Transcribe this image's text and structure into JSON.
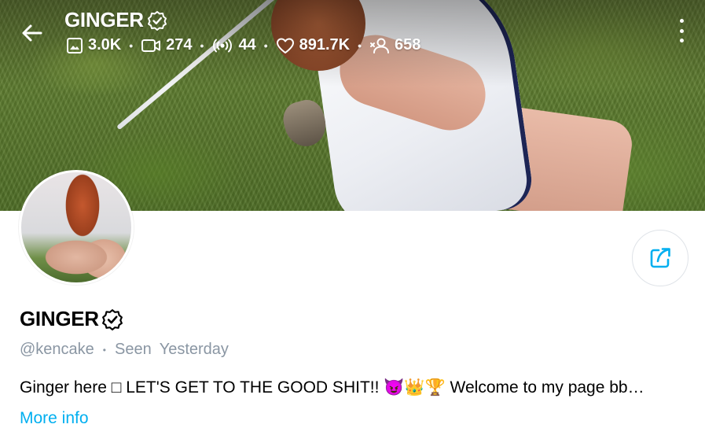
{
  "header": {
    "title": "GINGER",
    "stats": [
      {
        "icon": "image-icon",
        "value": "3.0K"
      },
      {
        "icon": "video-icon",
        "value": "274"
      },
      {
        "icon": "live-stream-icon",
        "value": "44"
      },
      {
        "icon": "heart-icon",
        "value": "891.7K"
      },
      {
        "icon": "fans-icon",
        "value": "658"
      }
    ]
  },
  "profile": {
    "name": "GINGER",
    "handle": "@kencake",
    "seen_label": "Seen",
    "seen_value": "Yesterday",
    "bio": "Ginger here □ LET'S GET TO THE GOOD SHIT!! 😈👑🏆 Welcome to my page bb…",
    "more_info": "More info"
  },
  "colors": {
    "accent": "#00aff0",
    "muted_text": "#8a96a3",
    "primary_text": "#000000",
    "background": "#ffffff"
  }
}
